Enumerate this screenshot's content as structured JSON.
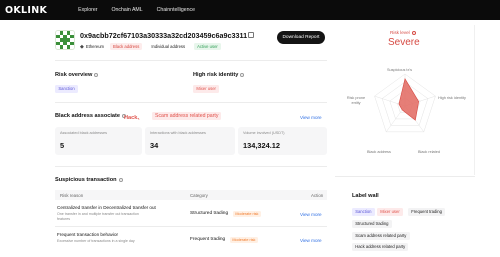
{
  "nav": {
    "logo": "OKLINK",
    "links": [
      "Explorer",
      "Onchain AML",
      "Chainntelligence"
    ]
  },
  "address": {
    "title": "0x9acbb72cf67103a30333a32cd203459c6a9c3311",
    "chain": "Ethereum",
    "tags": [
      "Black address",
      "Individual address",
      "Active user"
    ],
    "download_label": "Download Report"
  },
  "risk_overview": {
    "title": "Risk overview",
    "tag": "Sanction"
  },
  "high_risk_identity": {
    "title": "High risk identity",
    "tag": "Mixer user"
  },
  "black_association": {
    "title": "Black address associate",
    "hack": "Hack、",
    "scam": "Scam address related party",
    "view_more": "View more",
    "stats": [
      {
        "label": "Associated black addresses",
        "value": "5"
      },
      {
        "label": "Interactions with black addresses",
        "value": "34"
      },
      {
        "label": "Volume involved (USDT)",
        "value": "134,324.12"
      }
    ]
  },
  "suspicious": {
    "title": "Suspicious transaction",
    "columns": [
      "Risk reason",
      "Category",
      "Action"
    ],
    "rows": [
      {
        "reason": "Centralized transfer in Decentralized transfer out",
        "desc_line1": "One transfer in and multiple transfer out transaction",
        "desc_line2": "features",
        "category": "Structured trading",
        "risk_tag": "Moderate risk",
        "action": "View more"
      },
      {
        "reason": "Frequent transaction behavior",
        "desc_line1": "Excessive number of transactions in a single day",
        "category": "Frequent trading",
        "risk_tag": "Moderate risk",
        "action": "View more"
      }
    ]
  },
  "risk_level": {
    "label": "Risk level",
    "value": "Severe",
    "color": "#d64a43",
    "radar_axes": [
      "Suspicious tx's",
      "High risk identity",
      "Black related",
      "Black address",
      "Risk prone entity"
    ],
    "radar_values": [
      0.85,
      0.45,
      0.55,
      0.15,
      0.2
    ]
  },
  "label_wall": {
    "title": "Label wall",
    "tags": [
      "Sanction",
      "Mixer user",
      "Frequent trading",
      "Structured trading",
      "Scam address related party",
      "Hack address related party"
    ]
  }
}
